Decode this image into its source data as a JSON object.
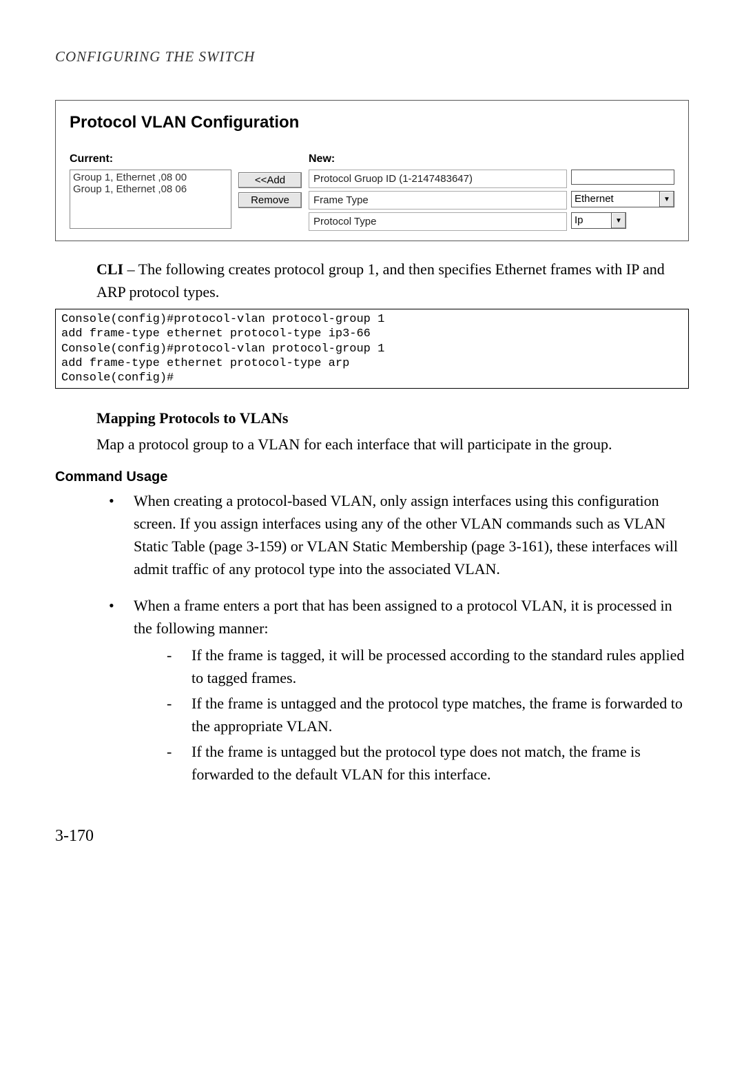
{
  "running_head": "CONFIGURING THE SWITCH",
  "figure": {
    "title": "Protocol VLAN Configuration",
    "current_label": "Current:",
    "current_items": [
      "Group 1, Ethernet ,08 00",
      "Group 1, Ethernet ,08 06"
    ],
    "btn_add": "<<Add",
    "btn_remove": "Remove",
    "new_label": "New:",
    "row1_label": "Protocol Gruop ID (1-2147483647)",
    "row1_value": "",
    "row2_label": "Frame Type",
    "row2_value": "Ethernet",
    "row3_label": "Protocol Type",
    "row3_value": "Ip"
  },
  "cli_intro_strong": "CLI",
  "cli_intro_rest": " – The following creates protocol group 1, and then specifies Ethernet frames with IP and ARP protocol types.",
  "cli_block": "Console(config)#protocol-vlan protocol-group 1\nadd frame-type ethernet protocol-type ip3-66\nConsole(config)#protocol-vlan protocol-group 1\nadd frame-type ethernet protocol-type arp\nConsole(config)#",
  "section_heading": "Mapping Protocols to VLANs",
  "section_intro": "Map a protocol group to a VLAN for each interface that will participate in the group.",
  "command_usage_label": "Command Usage",
  "bullet1": "When creating a protocol-based VLAN, only assign interfaces using this configuration screen. If you assign interfaces using any of the other VLAN commands such as VLAN Static Table (page 3-159) or VLAN Static Membership (page 3-161), these interfaces will admit traffic of any protocol type into the associated VLAN.",
  "bullet2_lead": "When a frame enters a port that has been assigned to a protocol VLAN, it is processed in the following manner:",
  "bullet2_sub1": "If the frame is tagged, it will be processed according to the standard rules applied to tagged frames.",
  "bullet2_sub2": "If the frame is untagged and the protocol type matches, the frame is forwarded to the appropriate VLAN.",
  "bullet2_sub3": "If the frame is untagged but the protocol type does not match, the frame is forwarded to the default VLAN for this interface.",
  "page_number": "3-170"
}
